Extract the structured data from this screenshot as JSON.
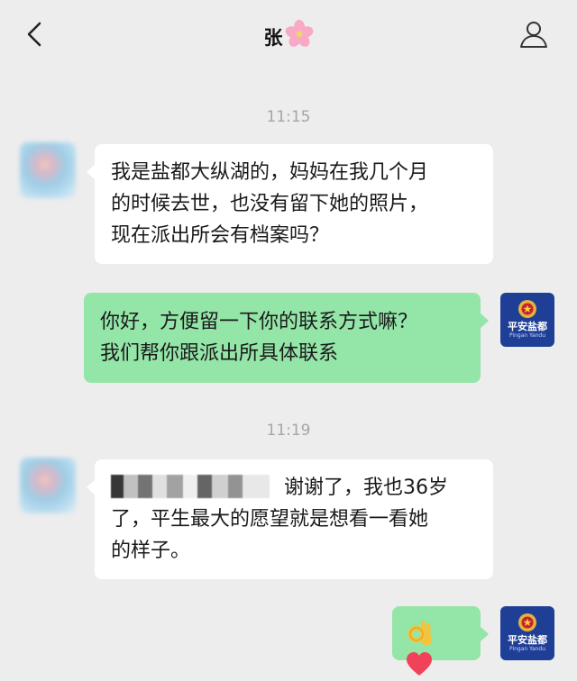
{
  "header": {
    "title": "张"
  },
  "messages": [
    {
      "time": "11:15"
    },
    {
      "lines": [
        "我是盐都大纵湖的，妈妈在我几个月",
        "的时候去世，也没有留下她的照片，",
        "现在派出所会有档案吗？"
      ]
    },
    {
      "lines": [
        "你好，方便留一下你的联系方式嘛？",
        "我们帮你跟派出所具体联系"
      ]
    },
    {
      "time": "11:19"
    },
    {
      "lines": [
        "谢谢了，我也36岁",
        "了，平生最大的愿望就是想看一看她",
        "的样子。"
      ]
    }
  ],
  "badge": {
    "title": "平安盐都",
    "subtitle": "Pingan Yandu"
  },
  "colors": {
    "incoming": "#ffffff",
    "outgoing": "#94e5a8",
    "background": "#ededed"
  },
  "icons": [
    "back-arrow-icon",
    "cherry-blossom-icon",
    "profile-icon",
    "ok-hand-emoji",
    "red-heart-emoji"
  ]
}
